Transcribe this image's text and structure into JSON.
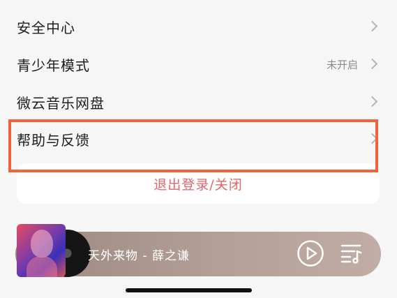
{
  "settings": {
    "items": [
      {
        "label": "安全中心",
        "value": ""
      },
      {
        "label": "青少年模式",
        "value": "未开启"
      },
      {
        "label": "微云音乐网盘",
        "value": ""
      },
      {
        "label": "帮助与反馈",
        "value": ""
      }
    ]
  },
  "logout": {
    "label": "退出登录/关闭"
  },
  "player": {
    "song": "天外来物 - 薛之谦",
    "play_icon": "play-circle-icon",
    "playlist_icon": "playlist-icon"
  },
  "colors": {
    "highlight": "#f0643c",
    "logout_text": "#e4656a",
    "player_bg": "#b49e98"
  }
}
